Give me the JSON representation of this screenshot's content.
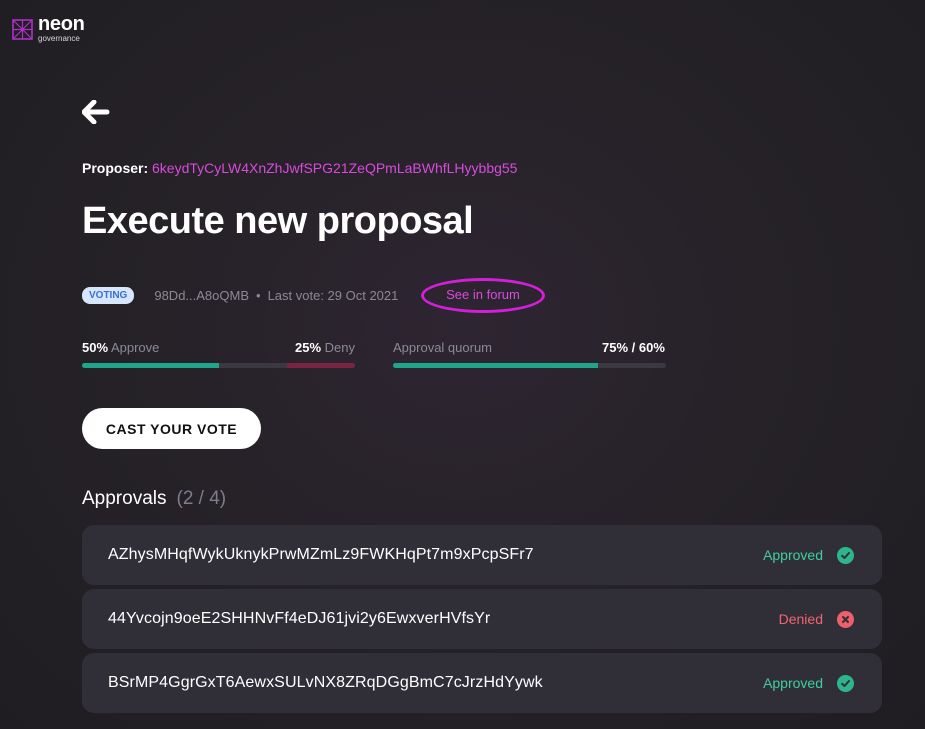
{
  "brand": {
    "name": "neon",
    "subtitle": "governance"
  },
  "proposer": {
    "label": "Proposer:",
    "address": "6keydTyCyLW4XnZhJwfSPG21ZeQPmLaBWhfLHyybbg55"
  },
  "title": "Execute new proposal",
  "meta": {
    "badge": "VOTING",
    "hash": "98Dd...A8oQMB",
    "separator": "•",
    "last_vote": "Last vote: 29 Oct 2021",
    "forum_link": "See in forum"
  },
  "votes": {
    "approve_pct": "50%",
    "approve_label": "Approve",
    "deny_pct": "25%",
    "deny_label": "Deny",
    "approve_fraction": 0.5,
    "deny_fraction": 0.25,
    "quorum_label": "Approval quorum",
    "quorum_value": "75% / 60%",
    "quorum_fraction": 0.75
  },
  "cast_button": "CAST YOUR VOTE",
  "approvals": {
    "heading": "Approvals",
    "count": "(2 / 4)",
    "rows": [
      {
        "address": "AZhysMHqfWykUknykPrwMZmLz9FWKHqPt7m9xPcpSFr7",
        "status": "Approved"
      },
      {
        "address": "44Yvcojn9oeE2SHHNvFf4eDJ61jvi2y6EwxverHVfsYr",
        "status": "Denied"
      },
      {
        "address": "BSrMP4GgrGxT6AewxSULvNX8ZRqDGgBmC7cJrzHdYywk",
        "status": "Approved"
      }
    ]
  },
  "colors": {
    "accent": "#d84bdc",
    "approve": "#1fa68a",
    "deny": "#7a2441",
    "approved_text": "#3ecf9e",
    "denied_text": "#f0646e"
  },
  "icons": {
    "back": "arrow-left-icon",
    "approved": "check-circle-icon",
    "denied": "x-circle-icon"
  }
}
